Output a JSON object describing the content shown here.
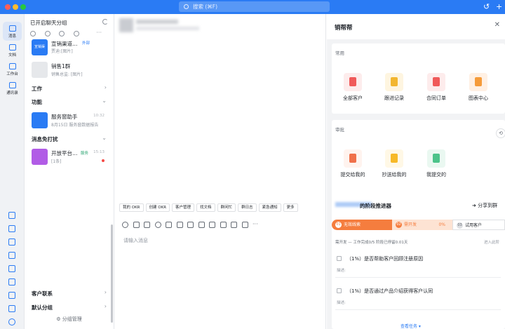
{
  "titlebar": {
    "search_placeholder": "搜索 (⌘F)",
    "history_icon": "↺",
    "add_icon": "+"
  },
  "rail": {
    "items": [
      {
        "label": "消息"
      },
      {
        "label": "文档"
      },
      {
        "label": "工作台"
      },
      {
        "label": "通讯录"
      }
    ]
  },
  "chatlist": {
    "header": "已开启聊天分组",
    "more": "···",
    "chats": [
      {
        "name": "宣销渠道…",
        "badge": "外部",
        "sub": "贾迪:[图片]",
        "avatar_text": "宣销渠",
        "color": "#2a7bf4"
      },
      {
        "name": "销售1群",
        "sub": "销售总监: [图片]",
        "color": "#e6e8eb"
      },
      {
        "name": "服务窗助手",
        "sub": "8月15日 服务窗数据报告",
        "time": "10:32",
        "color": "#2a7bf4"
      },
      {
        "name": "开放平台…",
        "tag": "服务",
        "sub": "[1条]",
        "time": "15:13",
        "color": "#b15ce6"
      }
    ],
    "sections": [
      "工作",
      "功能",
      "消息免打扰",
      "客户联系",
      "默认分组"
    ],
    "bottom": "⚙ 分组管理"
  },
  "chat": {
    "quick_buttons": [
      "我的 OKR",
      "创建 OKR",
      "客户管理",
      "找文档",
      "群闲忙",
      "群日志",
      "紧急通知",
      "更多"
    ],
    "input_placeholder": "请输入消息"
  },
  "panel": {
    "title": "销帮帮",
    "close": "✕",
    "common": {
      "title": "常用",
      "tiles": [
        {
          "label": "全部客户",
          "bg": "#fdecec",
          "fg": "#f05a5a"
        },
        {
          "label": "跟进记录",
          "bg": "#fef5e0",
          "fg": "#f2b630"
        },
        {
          "label": "合同订单",
          "bg": "#fdecec",
          "fg": "#f05a5a"
        },
        {
          "label": "图表中心",
          "bg": "#fff0e3",
          "fg": "#f59b3a"
        }
      ]
    },
    "approval": {
      "title": "审批",
      "tiles": [
        {
          "label": "提交给我的",
          "bg": "#fff3ee",
          "fg": "#f0704a"
        },
        {
          "label": "抄送给我的",
          "bg": "#fff8e6",
          "fg": "#f7b928"
        },
        {
          "label": "我提交的",
          "bg": "#eaf8f1",
          "fg": "#4cc38a"
        }
      ]
    },
    "advancer": {
      "title": "的阶段推进器",
      "share": "分享到群",
      "stages": [
        {
          "num": "01",
          "label": "无效线索"
        },
        {
          "num": "02",
          "label": "需开发",
          "pct": "0%"
        },
        {
          "num": "03",
          "label": "试用客户"
        }
      ],
      "meta_left": "需开发 — 工作完成0/5 阶段已停留0.01天",
      "meta_right": "进入此阶",
      "tasks": [
        {
          "title": "（1%）是否帮助客户回顾注册原因",
          "note": "描述:"
        },
        {
          "title": "（1%）是否通过产品介绍获得客户认同",
          "note": "描述:"
        }
      ],
      "view_all": "查看任务 ▾"
    }
  }
}
